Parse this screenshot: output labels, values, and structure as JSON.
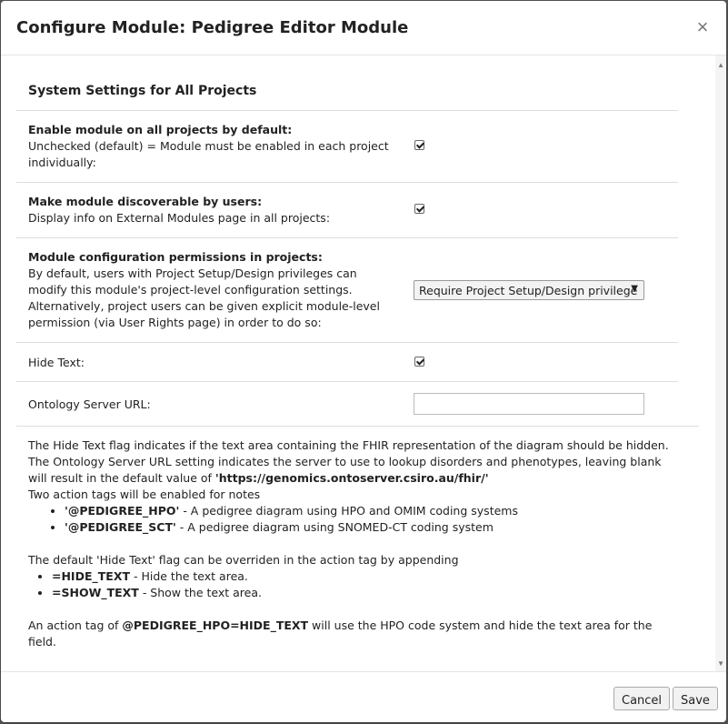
{
  "modal": {
    "title": "Configure Module: Pedigree Editor Module",
    "close_label": "×"
  },
  "section": {
    "title": "System Settings for All Projects"
  },
  "settings": [
    {
      "title": "Enable module on all projects by default:",
      "description": "Unchecked (default) = Module must be enabled in each project individually:",
      "checked": true
    },
    {
      "title": "Make module discoverable by users:",
      "description": "Display info on External Modules page in all projects:",
      "checked": true
    },
    {
      "title": "Module configuration permissions in projects:",
      "description": "By default, users with Project Setup/Design privileges can modify this module's project-level configuration settings. Alternatively, project users can be given explicit module-level permission (via User Rights page) in order to do so:",
      "select_value": "Require Project Setup/Design privilege"
    },
    {
      "title": "Hide Text:",
      "checked": true
    },
    {
      "title": "Ontology Server URL:",
      "value": ""
    }
  ],
  "help": {
    "line1": "The Hide Text flag indicates if the text area containing the FHIR representation of the diagram should be hidden.",
    "line2_pre": "The Ontology Server URL setting indicates the server to use to lookup disorders and phenotypes, leaving blank will result in the default value of ",
    "line2_url": "'https://genomics.ontoserver.csiro.au/fhir/'",
    "line3": "Two action tags will be enabled for notes",
    "tags": [
      {
        "name": "'@PEDIGREE_HPO'",
        "desc": " - A pedigree diagram using HPO and OMIM coding systems"
      },
      {
        "name": "'@PEDIGREE_SCT'",
        "desc": " - A pedigree diagram using SNOMED-CT coding system"
      }
    ],
    "line4": "The default 'Hide Text' flag can be overriden in the action tag by appending",
    "flags": [
      {
        "name": "=HIDE_TEXT",
        "desc": " - Hide the text area."
      },
      {
        "name": "=SHOW_TEXT",
        "desc": " - Show the text area."
      }
    ],
    "line5_pre": "An action tag of ",
    "line5_tag": "@PEDIGREE_HPO=HIDE_TEXT",
    "line5_post": " will use the HPO code system and hide the text area for the field."
  },
  "footer": {
    "cancel_label": "Cancel",
    "save_label": "Save"
  },
  "icons": {
    "close": "close-icon",
    "dropdown": "chevron-down-icon"
  }
}
